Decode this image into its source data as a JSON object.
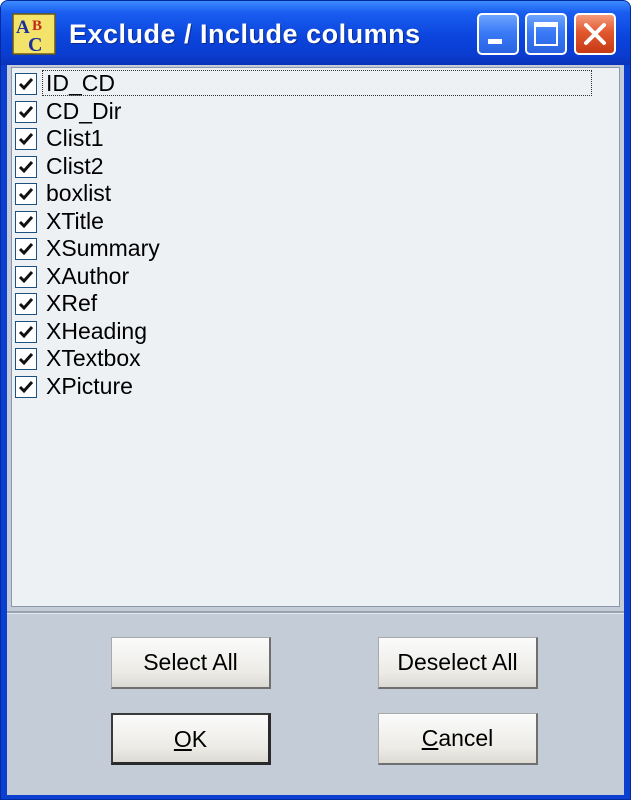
{
  "window": {
    "title": "Exclude / Include columns",
    "icon": "app-icon-abc"
  },
  "title_buttons": {
    "minimize_icon": "minimize-icon",
    "maximize_icon": "maximize-icon",
    "close_icon": "close-icon"
  },
  "columns": {
    "focused_index": 0,
    "items": [
      {
        "label": "ID_CD",
        "checked": true
      },
      {
        "label": "CD_Dir",
        "checked": true
      },
      {
        "label": "Clist1",
        "checked": true
      },
      {
        "label": "Clist2",
        "checked": true
      },
      {
        "label": "boxlist",
        "checked": true
      },
      {
        "label": "XTitle",
        "checked": true
      },
      {
        "label": "XSummary",
        "checked": true
      },
      {
        "label": "XAuthor",
        "checked": true
      },
      {
        "label": "XRef",
        "checked": true
      },
      {
        "label": "XHeading",
        "checked": true
      },
      {
        "label": "XTextbox",
        "checked": true
      },
      {
        "label": "XPicture",
        "checked": true
      }
    ]
  },
  "buttons": {
    "select_all": "Select All",
    "deselect_all": "Deselect All",
    "ok_mnemonic": "O",
    "ok_rest": "K",
    "cancel_mnemonic": "C",
    "cancel_rest": "ancel"
  },
  "colors": {
    "title_bar": "#0a3fd0",
    "dialog_face": "#c4ccd8",
    "list_background": "#eef1f4",
    "close_button": "#e1582e"
  }
}
